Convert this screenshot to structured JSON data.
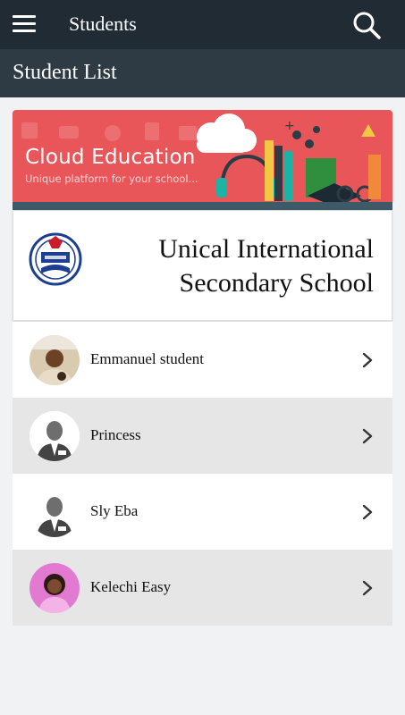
{
  "header": {
    "title": "Students",
    "menu_icon": "hamburger-menu-icon",
    "search_icon": "search-icon"
  },
  "subheader": {
    "title": "Student List"
  },
  "banner": {
    "title": "Cloud Education",
    "subtitle": "Unique platform for your school...",
    "colors": {
      "background": "#e9565a",
      "strip": "#3d5a66"
    }
  },
  "school": {
    "name_line1": "Unical International",
    "name_line2": "Secondary School"
  },
  "students": [
    {
      "name": "Emmanuel student",
      "avatar": "photo-boy"
    },
    {
      "name": "Princess",
      "avatar": "placeholder-person"
    },
    {
      "name": "Sly Eba",
      "avatar": "placeholder-person"
    },
    {
      "name": "Kelechi Easy",
      "avatar": "photo-girl"
    }
  ],
  "colors": {
    "topbar": "#212b34",
    "subbar": "#2e3a44",
    "page_bg": "#f1f2f4",
    "row_alt": "#e6e6e6"
  }
}
